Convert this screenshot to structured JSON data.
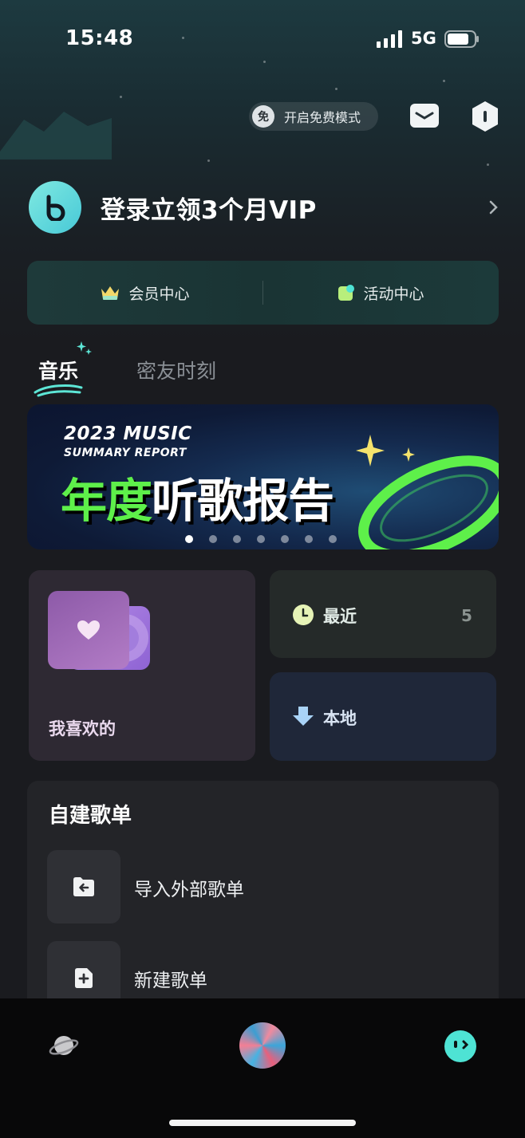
{
  "status_bar": {
    "time": "15:48",
    "network": "5G"
  },
  "header": {
    "free_mode_badge": "免",
    "free_mode_label": "开启免费模式",
    "mail_icon": "mail-icon",
    "settings_icon": "hexagon-settings-icon"
  },
  "login": {
    "title": "登录立领3个月VIP",
    "logo_icon": "app-logo-b-icon"
  },
  "member_bar": {
    "member_center": "会员中心",
    "activity_center": "活动中心"
  },
  "tabs": [
    {
      "label": "音乐",
      "active": true
    },
    {
      "label": "密友时刻",
      "active": false
    }
  ],
  "banner": {
    "line1": "2023 MUSIC",
    "line2": "SUMMARY REPORT",
    "title_green": "年度",
    "title_white": "听歌报告",
    "page_count": 7,
    "active_index": 0
  },
  "cards": {
    "favorites": {
      "label": "我喜欢的"
    },
    "recent": {
      "label": "最近",
      "count": "5"
    },
    "local": {
      "label": "本地"
    }
  },
  "playlists": {
    "title": "自建歌单",
    "items": [
      {
        "label": "导入外部歌单",
        "icon": "import-folder-icon"
      },
      {
        "label": "新建歌单",
        "icon": "new-file-icon"
      }
    ]
  },
  "bottom_nav": [
    {
      "icon": "planet-icon"
    },
    {
      "icon": "now-playing-disc-icon"
    },
    {
      "icon": "profile-face-icon"
    }
  ],
  "colors": {
    "accent_green": "#5ef04a",
    "brand_cyan": "#4ee3d4",
    "background": "#1a1b1f"
  }
}
